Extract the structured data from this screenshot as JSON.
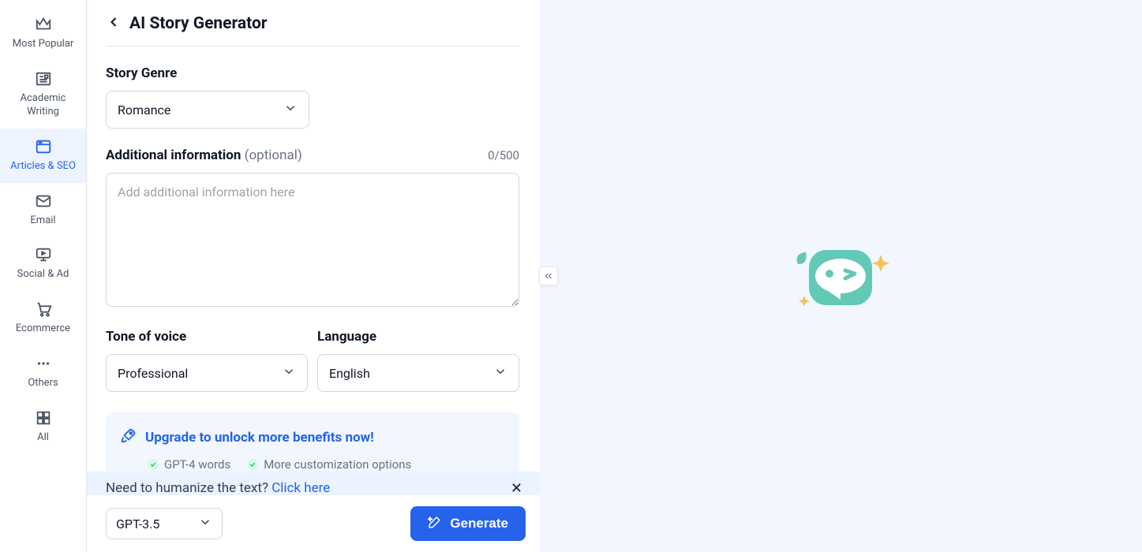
{
  "sidebar": {
    "items": [
      {
        "label": "Most Popular"
      },
      {
        "label": "Academic Writing"
      },
      {
        "label": "Articles & SEO"
      },
      {
        "label": "Email"
      },
      {
        "label": "Social & Ad"
      },
      {
        "label": "Ecommerce"
      },
      {
        "label": "Others"
      },
      {
        "label": "All"
      }
    ]
  },
  "header": {
    "title": "AI Story Generator"
  },
  "form": {
    "genre_label": "Story Genre",
    "genre_value": "Romance",
    "additional_label": "Additional information",
    "additional_optional": "(optional)",
    "additional_counter": "0/500",
    "additional_placeholder": "Add additional information here",
    "tone_label": "Tone of voice",
    "tone_value": "Professional",
    "lang_label": "Language",
    "lang_value": "English"
  },
  "upgrade": {
    "title": "Upgrade to unlock more benefits now!",
    "feat1": "GPT-4 words",
    "feat2": "More customization options"
  },
  "banner": {
    "text": "Need to humanize the text? ",
    "link": "Click here"
  },
  "footer": {
    "model": "GPT-3.5",
    "generate": "Generate"
  }
}
